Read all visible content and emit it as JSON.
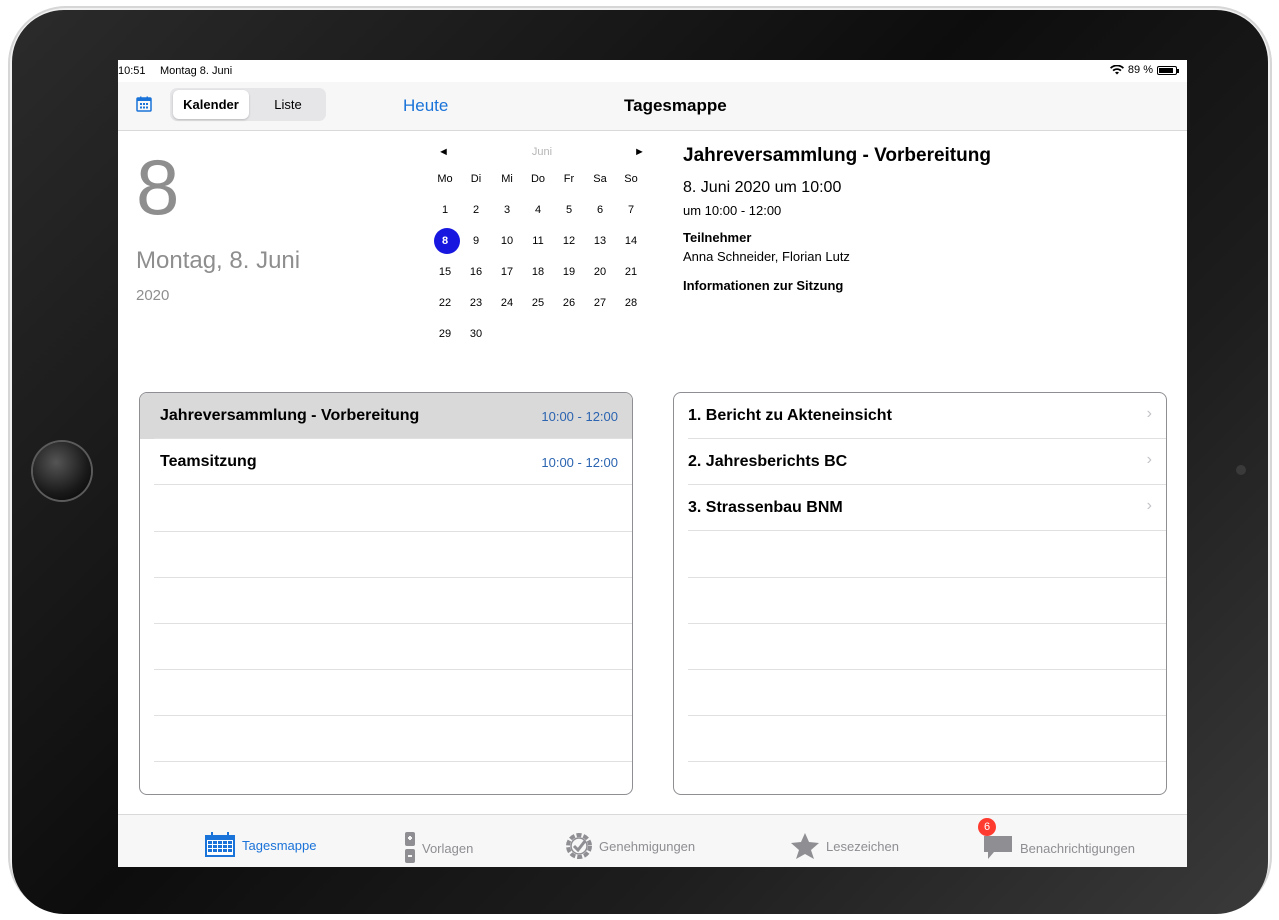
{
  "statusbar": {
    "time": "10:51",
    "date": "Montag 8. Juni",
    "battery": "89 %",
    "battery_level": 0.89
  },
  "navbar": {
    "segments": [
      "Kalender",
      "Liste"
    ],
    "selected_segment": "Kalender",
    "today_label": "Heute",
    "title": "Tagesmappe"
  },
  "day": {
    "number": "8",
    "weekday_date": "Montag, 8. Juni",
    "year": "2020"
  },
  "minical": {
    "month": "Juni",
    "prev": "◄",
    "next": "►",
    "weekdays": [
      "Mo",
      "Di",
      "Mi",
      "Do",
      "Fr",
      "Sa",
      "So"
    ],
    "weeks": [
      [
        "1",
        "2",
        "3",
        "4",
        "5",
        "6",
        "7"
      ],
      [
        "8",
        "9",
        "10",
        "11",
        "12",
        "13",
        "14"
      ],
      [
        "15",
        "16",
        "17",
        "18",
        "19",
        "20",
        "21"
      ],
      [
        "22",
        "23",
        "24",
        "25",
        "26",
        "27",
        "28"
      ],
      [
        "29",
        "30",
        "",
        "",
        "",
        "",
        ""
      ]
    ],
    "selected": "8"
  },
  "event": {
    "title": "Jahreversammlung - Vorbereitung",
    "when": "8. Juni 2020 um 10:00",
    "time": "um 10:00 - 12:00",
    "participants_label": "Teilnehmer",
    "participants": "Anna Schneider, Florian Lutz",
    "info_label": "Informationen zur Sitzung"
  },
  "meetings": [
    {
      "title": "Jahreversammlung - Vorbereitung",
      "time": "10:00 - 12:00",
      "selected": true
    },
    {
      "title": "Teamsitzung",
      "time": "10:00 - 12:00",
      "selected": false
    }
  ],
  "agenda": [
    {
      "title": "1. Bericht zu Akteneinsicht",
      "chevron": "›"
    },
    {
      "title": "2. Jahresberichts BC",
      "chevron": "›"
    },
    {
      "title": "3. Strassenbau BNM",
      "chevron": "›"
    }
  ],
  "tabs": [
    {
      "label": "Tagesmappe",
      "icon": "calendar-icon",
      "active": true
    },
    {
      "label": "Vorlagen",
      "icon": "document-icon",
      "active": false
    },
    {
      "label": "Genehmigungen",
      "icon": "approval-check-icon",
      "active": false
    },
    {
      "label": "Lesezeichen",
      "icon": "star-icon",
      "active": false
    },
    {
      "label": "Benachrichtigungen",
      "icon": "chat-bubble-icon",
      "active": false,
      "badge": "6"
    }
  ],
  "colors": {
    "accent": "#1a73d9",
    "selected_day": "#1717e0",
    "badge": "#ff3b30",
    "time_text": "#2b64b0"
  }
}
